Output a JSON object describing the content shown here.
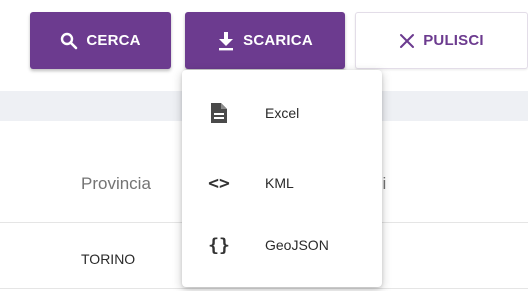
{
  "toolbar": {
    "search_label": "CERCA",
    "search_icon": "search-icon",
    "download_label": "SCARICA",
    "download_icon": "download-icon",
    "clear_label": "PULISCI",
    "clear_icon": "close-icon"
  },
  "table": {
    "columns": [
      "Provincia",
      "ni"
    ],
    "rows": [
      [
        "TORINO"
      ]
    ]
  },
  "download_menu": {
    "items": [
      {
        "label": "Excel",
        "icon": "document-icon"
      },
      {
        "label": "KML",
        "icon": "code-icon",
        "glyph": "<>"
      },
      {
        "label": "GeoJSON",
        "icon": "braces-icon",
        "glyph": "{}"
      }
    ]
  },
  "colors": {
    "accent": "#6c3b8f",
    "header_band": "#eef0f4",
    "header_text": "#747474"
  }
}
